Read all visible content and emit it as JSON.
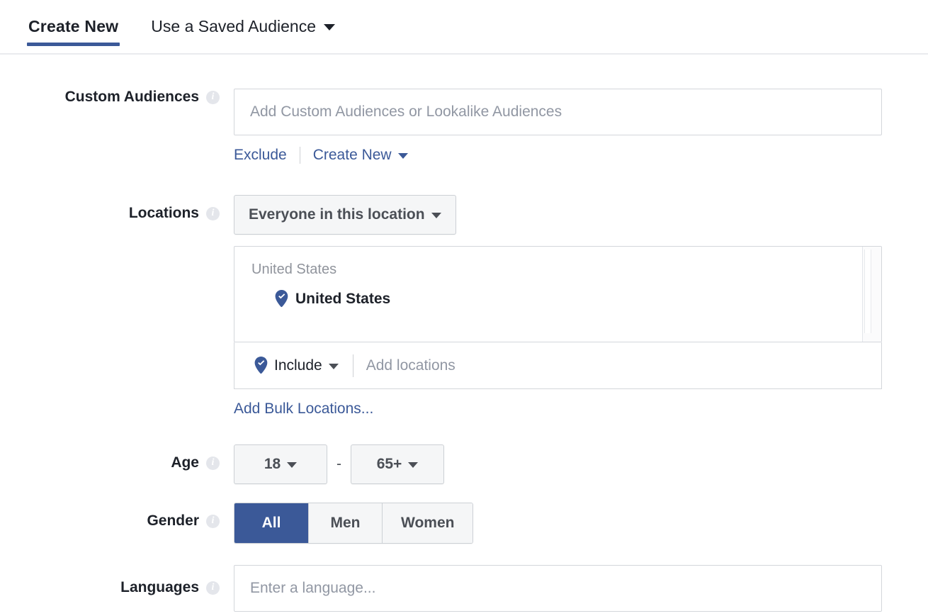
{
  "tabs": [
    {
      "label": "Create New",
      "active": true,
      "has_caret": false
    },
    {
      "label": "Use a Saved Audience",
      "active": false,
      "has_caret": true
    }
  ],
  "colors": {
    "accent_blue": "#3b5998",
    "link_blue": "#3b5998",
    "border_gray": "#d3d6db",
    "button_gray": "#f5f6f7",
    "placeholder_gray": "#9197a3",
    "pin_blue": "#3b5998"
  },
  "fields": {
    "custom_audiences": {
      "label": "Custom Audiences",
      "info_icon": "info-icon",
      "placeholder": "Add Custom Audiences or Lookalike Audiences",
      "value": "",
      "links": [
        {
          "label": "Exclude"
        },
        {
          "label": "Create New",
          "has_caret": true
        }
      ]
    },
    "locations": {
      "label": "Locations",
      "info_icon": "info-icon",
      "scope_dropdown": {
        "value": "Everyone in this location",
        "caret": "chevron-down-icon"
      },
      "group_title": "United States",
      "selected": [
        {
          "name": "United States",
          "icon": "map-pin-check-icon"
        }
      ],
      "include_control": {
        "label": "Include",
        "icon": "map-pin-check-icon",
        "caret": "chevron-down-icon"
      },
      "add_placeholder": "Add locations",
      "bulk_link": "Add Bulk Locations..."
    },
    "age": {
      "label": "Age",
      "info_icon": "info-icon",
      "min": "18",
      "max": "65+",
      "separator": "-"
    },
    "gender": {
      "label": "Gender",
      "info_icon": "info-icon",
      "options": [
        {
          "label": "All",
          "selected": true
        },
        {
          "label": "Men",
          "selected": false
        },
        {
          "label": "Women",
          "selected": false
        }
      ]
    },
    "languages": {
      "label": "Languages",
      "info_icon": "info-icon",
      "placeholder": "Enter a language...",
      "value": ""
    }
  },
  "icon_glyph": {
    "info": "i"
  }
}
